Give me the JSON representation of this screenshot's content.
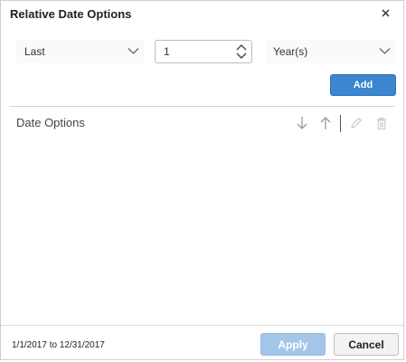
{
  "dialog": {
    "title": "Relative Date Options"
  },
  "controls": {
    "period_value": "Last",
    "count_value": "1",
    "unit_value": "Year(s)",
    "add_label": "Add"
  },
  "options": {
    "header_label": "Date Options",
    "items": []
  },
  "footer": {
    "range_text": "1/1/2017 to 12/31/2017",
    "apply_label": "Apply",
    "cancel_label": "Cancel"
  },
  "colors": {
    "primary": "#3b86cf",
    "primary_disabled": "#a3c5e8",
    "icon_gray": "#9a9a9a",
    "icon_disabled": "#c8c8c8"
  },
  "icons": {
    "close": "close-icon",
    "chevron": "chevron-down-icon",
    "spinner": "spinner-arrows-icon",
    "move_down": "arrow-down-icon",
    "move_up": "arrow-up-icon",
    "edit": "pencil-icon",
    "delete": "trash-icon"
  }
}
